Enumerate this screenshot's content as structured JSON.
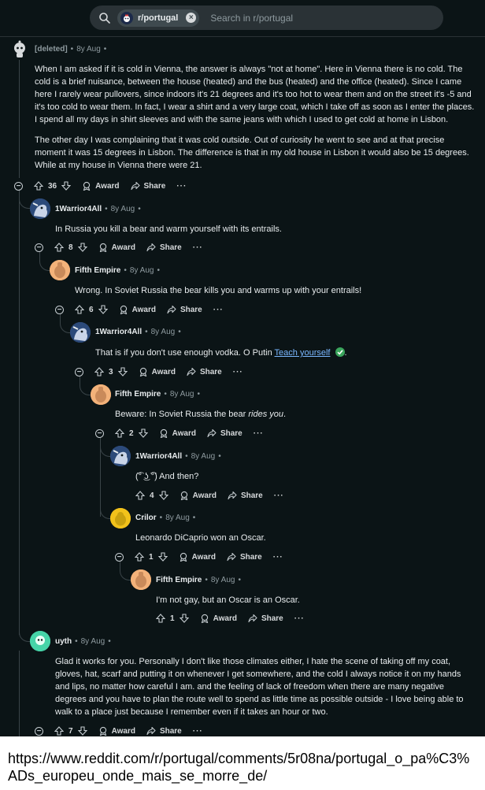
{
  "search": {
    "community": "r/portugal",
    "placeholder": "Search in r/portugal",
    "clear_symbol": "×"
  },
  "actions": {
    "award_label": "Award",
    "share_label": "Share",
    "more_label": "···",
    "collapse_symbol": "−"
  },
  "comments": [
    {
      "author": "[deleted]",
      "time": "8y Aug",
      "body": [
        "When I am asked if it is cold in Vienna, the answer is always \"not at home\". Here in Vienna there is no cold. The cold is a brief nuisance, between the house (heated) and the bus (heated) and the office (heated). Since I came here I rarely wear pullovers, since indoors it's 21 degrees and it's too hot to wear them and on the street it's -5 and it's too cold to wear them. In fact, I wear a shirt and a very large coat, which I take off as soon as I enter the places. I spend all my days in shirt sleeves and with the same jeans with which I used to get cold at home in Lisbon.",
        "The other day I was complaining that it was cold outside. Out of curiosity he went to see and at that precise moment it was 15 degrees in Lisbon. The difference is that in my old house in Lisbon it would also be 15 degrees. While at my house in Vienna there were 21."
      ],
      "score": "36"
    },
    {
      "author": "1Warrior4All",
      "time": "8y Aug",
      "body": "In Russia you kill a bear and warm yourself with its entrails.",
      "score": "8"
    },
    {
      "author": "Fifth Empire",
      "time": "8y Aug",
      "body": "Wrong. In Soviet Russia the bear kills you and warms up with your entrails!",
      "score": "6"
    },
    {
      "author": "1Warrior4All",
      "time": "8y Aug",
      "body_prefix": "That is if you don't use enough vodka. O Putin ",
      "link": "Teach yourself",
      "body_suffix": ".",
      "score": "3"
    },
    {
      "author": "Fifth Empire",
      "time": "8y Aug",
      "body_prefix": "Beware: In Soviet Russia the bear ",
      "body_em": "rides you",
      "body_suffix": ".",
      "score": "2"
    },
    {
      "author": "1Warrior4All",
      "time": "8y Aug",
      "body": "(͡° ͜ʖ ͡°) And then?",
      "score": "4"
    },
    {
      "author": "Crilor",
      "time": "8y Aug",
      "body": "Leonardo DiCaprio won an Oscar.",
      "score": "1"
    },
    {
      "author": "Fifth Empire",
      "time": "8y Aug",
      "body": "I'm not gay, but an Oscar is an Oscar.",
      "score": "1"
    },
    {
      "author": "uyth",
      "time": "8y Aug",
      "body": "Glad it works for you. Personally I don't like those climates either, I hate the scene of taking off my coat, gloves, hat, scarf and putting it on whenever I get somewhere, and the cold I always notice it on my hands and lips, no matter how careful I am. and the feeling of lack of freedom when there are many negative degrees and you have to plan the route well to spend as little time as possible outside - I love being able to walk to a place just because I remember even if it takes an hour or two.",
      "score": "7"
    }
  ],
  "caption_url": "https://www.reddit.com/r/portugal/comments/5r08na/portugal_o_pa%C3%ADs_europeu_onde_mais_se_morre_de/",
  "colors": {
    "background": "#0b1416",
    "link": "#7ab7ff",
    "text": "#e8ecee",
    "muted": "#8e9a9f"
  }
}
